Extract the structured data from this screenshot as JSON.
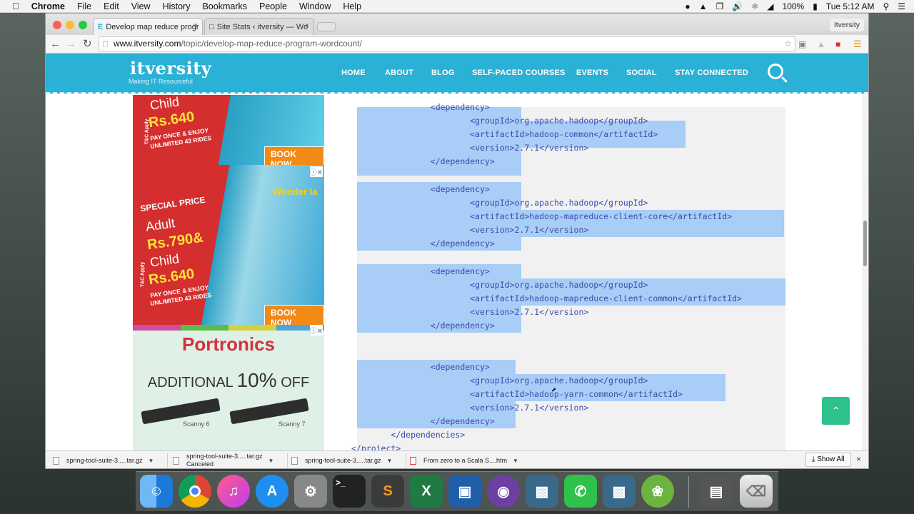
{
  "menubar": {
    "app": "Chrome",
    "items": [
      "File",
      "Edit",
      "View",
      "History",
      "Bookmarks",
      "People",
      "Window",
      "Help"
    ],
    "battery": "100%",
    "clock": "Tue 5:12 AM"
  },
  "browser": {
    "tabs": [
      {
        "title": "Develop map reduce progr"
      },
      {
        "title": "Site Stats ‹ itversity — Wo"
      }
    ],
    "profile": "Itversity",
    "url_host": "www.itversity.com",
    "url_path": "/topic/develop-map-reduce-program-wordcount/"
  },
  "site": {
    "logo": "itversity",
    "tagline": "Making IT Resourceful",
    "nav": [
      "HOME",
      "ABOUT",
      "BLOG",
      "SELF-PACED COURSES",
      "EVENTS",
      "SOCIAL",
      "STAY CONNECTED"
    ]
  },
  "ads": {
    "child_label": "Child",
    "child_price": "Rs.640",
    "pay_once": "PAY ONCE & ENJOY",
    "unlimited": "UNLIMITED 43 RIDES",
    "book_now": "BOOK NOW",
    "special_price": "SPECIAL PRICE",
    "adult_label": "Adult",
    "adult_price": "Rs.790&",
    "tnc": "T&C Apply",
    "park": "Wonder la",
    "brand": "Portronics",
    "offer_prefix": "ADDITIONAL",
    "offer_pct": "10%",
    "offer_suffix": "OFF",
    "scanner1": "Scanny 6",
    "scanner2": "Scanny 7"
  },
  "code": {
    "lines": [
      "                <dependency>",
      "                        <groupId>org.apache.hadoop</groupId>",
      "                        <artifactId>hadoop-common</artifactId>",
      "                        <version>2.7.1</version>",
      "                </dependency>",
      "",
      "                <dependency>",
      "                        <groupId>org.apache.hadoop</groupId>",
      "                        <artifactId>hadoop-mapreduce-client-core</artifactId>",
      "                        <version>2.7.1</version>",
      "                </dependency>",
      "",
      "                <dependency>",
      "                        <groupId>org.apache.hadoop</groupId>",
      "                        <artifactId>hadoop-mapreduce-client-common</artifactId>",
      "                        <version>2.7.1</version>",
      "                </dependency>",
      "",
      "",
      "                <dependency>",
      "                        <groupId>org.apache.hadoop</groupId>",
      "                        <artifactId>hadoop-yarn-common</artifactId>",
      "                        <version>2.7.1</version>",
      "                </dependency>",
      "        </dependencies>",
      "</project>"
    ]
  },
  "downloads": {
    "items": [
      {
        "name": "spring-tool-suite-3.....tar.gz",
        "status": ""
      },
      {
        "name": "spring-tool-suite-3.....tar.gz",
        "status": "Canceled"
      },
      {
        "name": "spring-tool-suite-3.....tar.gz",
        "status": ""
      },
      {
        "name": "From zero to a Scala S....htm",
        "status": ""
      }
    ],
    "show_all": "Show All"
  },
  "dock": {
    "icons": [
      "finder-icon",
      "chrome-icon",
      "itunes-icon",
      "app-store-icon",
      "system-preferences-icon",
      "terminal-icon",
      "sublime-text-icon",
      "excel-icon",
      "virtualbox-icon",
      "github-icon",
      "screen-sharing-icon",
      "facetime-icon",
      "screen-sharing-icon",
      "spring-tool-suite-icon",
      "downloads-stack-icon",
      "trash-icon"
    ]
  }
}
